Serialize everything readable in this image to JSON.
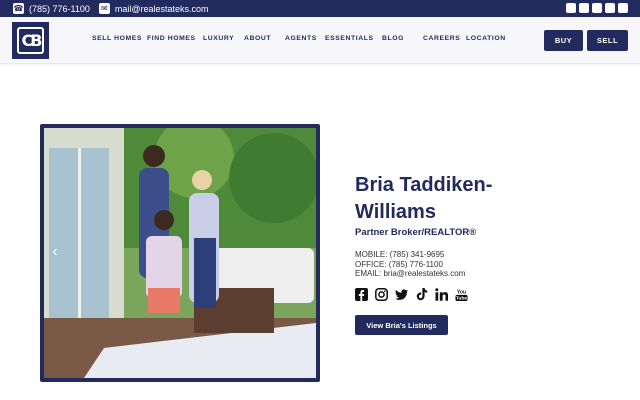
{
  "topbar": {
    "phone": "(785) 776-1100",
    "email": "mail@realestateks.com",
    "phone_icon": "phone-icon",
    "email_icon": "mail-icon",
    "social_icons": [
      "facebook-icon",
      "instagram-icon",
      "linkedin-icon",
      "bookmark-icon",
      "tiktok-icon"
    ]
  },
  "header": {
    "logo_text": "CB",
    "nav": [
      "SELL HOMES",
      "FIND HOMES",
      "LUXURY",
      "ABOUT",
      "AGENTS",
      "ESSENTIALS",
      "BLOG",
      "CAREERS",
      "LOCATION"
    ],
    "buy_label": "BUY",
    "sell_label": "SELL"
  },
  "profile": {
    "name": "Bria Taddiken-Williams",
    "title": "Partner Broker/REALTOR®",
    "mobile": "MOBILE: (785) 341-9695",
    "office": "OFFICE: (785) 776-1100",
    "email": "EMAIL: bria@realestateks.com",
    "social_icons": [
      "facebook-icon",
      "instagram-icon",
      "twitter-icon",
      "tiktok-icon",
      "linkedin-icon",
      "youtube-icon"
    ],
    "listings_button": "View Bria's Listings"
  },
  "carousel": {
    "prev_icon": "chevron-left-icon"
  },
  "colors": {
    "brand": "#222a5e",
    "topbar": "#222a5e"
  }
}
